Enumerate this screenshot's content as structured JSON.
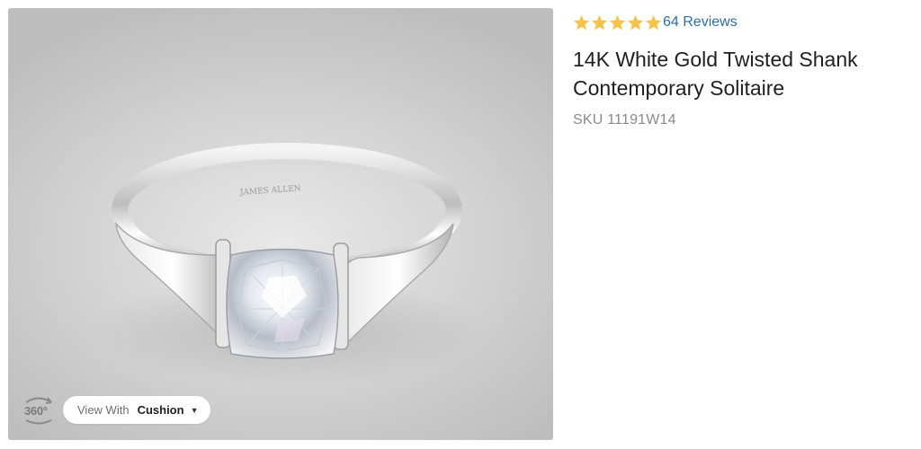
{
  "product": {
    "rating": {
      "stars": 5,
      "star_icon": "star-icon",
      "star_color": "#f5c24c",
      "reviews_label": "64 Reviews"
    },
    "title": "14K White Gold Twisted Shank Contemporary Solitaire",
    "sku_label": "SKU 11191W14"
  },
  "image_viewer": {
    "image_description_icon": "ring-image",
    "viewer_360_label": "360°",
    "view_with": {
      "prefix": "View With",
      "selected_shape": "Cushion",
      "caret_icon": "caret-down-icon"
    }
  },
  "colors": {
    "link": "#2d6ea6",
    "sku": "#8a8a8a",
    "title": "#1f1f1f"
  }
}
